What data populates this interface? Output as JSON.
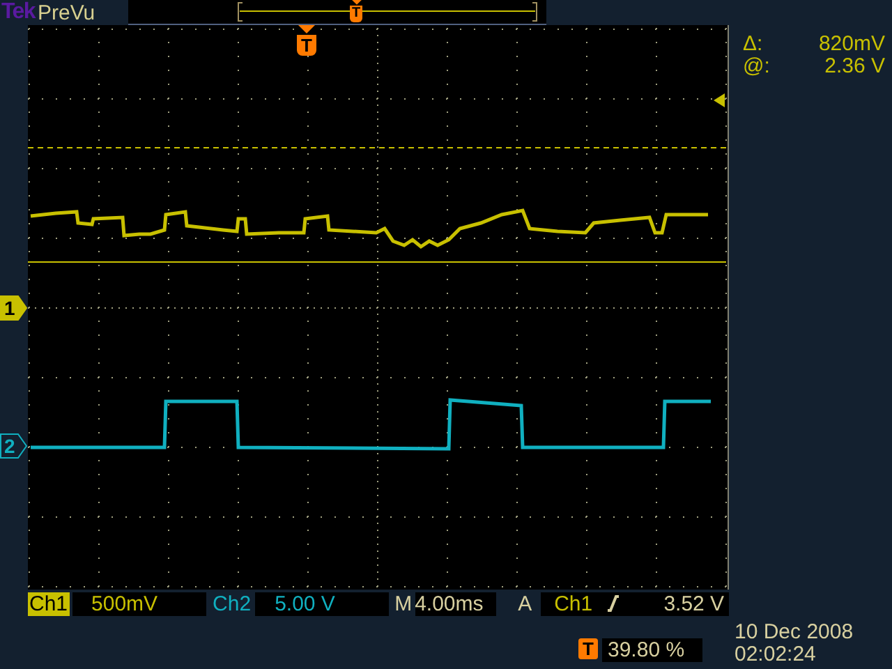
{
  "header": {
    "brand": "Tek",
    "mode": "PreVu"
  },
  "record_view": {
    "trigger_label": "T"
  },
  "display": {
    "trigger_label": "T"
  },
  "cursors": [
    {
      "symbol": "Δ:",
      "value": "820mV"
    },
    {
      "symbol": "@:",
      "value": "2.36 V"
    }
  ],
  "channels": [
    {
      "label": "Ch1",
      "marker": "1",
      "scale": "500mV",
      "color": "#c8c000",
      "selected": true
    },
    {
      "label": "Ch2",
      "marker": "2",
      "scale": "5.00 V",
      "color": "#10b0c0",
      "selected": false
    }
  ],
  "timebase": {
    "label": "M",
    "value": "4.00ms"
  },
  "trigger": {
    "mode": "A",
    "source": "Ch1",
    "level": "3.52 V"
  },
  "trigger_position": {
    "icon": "T",
    "value": "39.80 %"
  },
  "clock": {
    "date": "10 Dec 2008",
    "time": "02:02:24"
  }
}
